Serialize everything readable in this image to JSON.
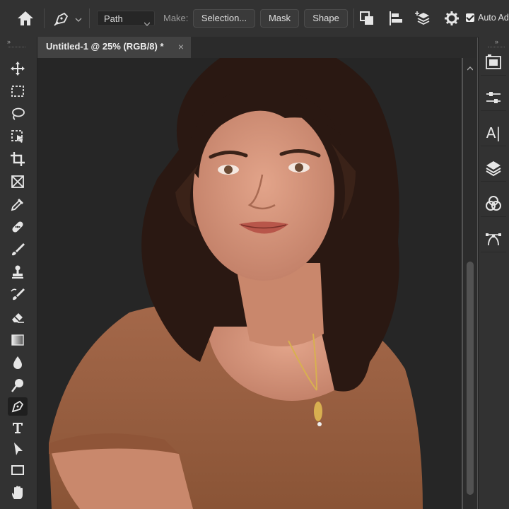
{
  "options_bar": {
    "tool_mode": "Path",
    "make_label": "Make:",
    "selection_button": "Selection...",
    "mask_button": "Mask",
    "shape_button": "Shape",
    "auto_add_label": "Auto Ad",
    "auto_add_checked": true
  },
  "document": {
    "tab_title": "Untitled-1 @ 25% (RGB/8) *",
    "close_glyph": "×"
  },
  "toolbar": {
    "collapse_glyph": "»",
    "active_tool": "pen-tool",
    "tools": [
      "move",
      "rectangular-marquee",
      "lasso",
      "object-selection",
      "crop",
      "frame",
      "eyedropper",
      "spot-healing-brush",
      "brush",
      "clone-stamp",
      "history-brush",
      "eraser",
      "gradient",
      "blur",
      "dodge",
      "pen",
      "type",
      "path-selection",
      "rectangle",
      "hand"
    ]
  },
  "right_panel": {
    "collapse_glyph": "»",
    "character_label": "A|",
    "icons": [
      "libraries",
      "adjustments",
      "character",
      "layers",
      "channels",
      "paths"
    ]
  },
  "colors": {
    "ui_dark": "#323232",
    "canvas_bg": "#262626",
    "accent_text": "#e0e0e0"
  }
}
